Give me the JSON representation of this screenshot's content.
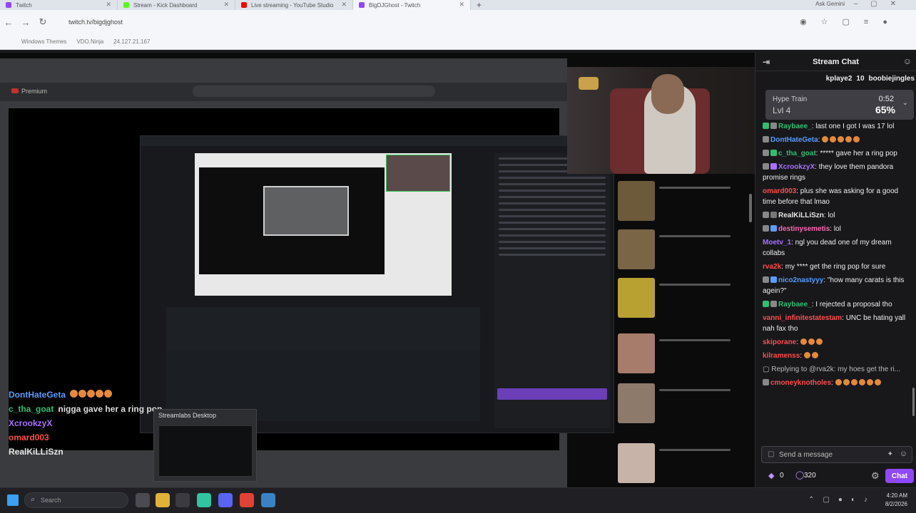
{
  "browser": {
    "tabs": [
      {
        "label": "Twitch",
        "color": "#9147ff",
        "active": false
      },
      {
        "label": "Stream - Kick Dashboard",
        "color": "#53fc18",
        "active": false
      },
      {
        "label": "Live streaming - YouTube Studio",
        "color": "#ff0000",
        "active": false
      },
      {
        "label": "BigDJGhost - Twitch",
        "color": "#9147ff",
        "active": true
      }
    ],
    "ask_gemini": "Ask Gemini",
    "url": "twitch.tv/bigdjghost",
    "bookmarks": [
      "Windows Themes",
      "VDO.Ninja",
      "24.127.21.167"
    ]
  },
  "video": {
    "youtube_logo": "Premium",
    "overlay_chat": [
      {
        "user": "DontHateGeta",
        "color": "#5b9cff",
        "text": ""
      },
      {
        "user": "c_tha_goat",
        "color": "#2fbf71",
        "text": "nigga gave her a ring pop"
      },
      {
        "user": "XcrookzyX",
        "color": "#a970ff",
        "text": ""
      },
      {
        "user": "omard003",
        "color": "#ff4d4d",
        "text": ""
      },
      {
        "user": "RealKiLLiSzn",
        "color": "#e6e6e6",
        "text": ""
      }
    ],
    "streamlabs_popup": "Streamlabs Desktop"
  },
  "chat": {
    "title": "Stream Chat",
    "gifters": [
      {
        "name": "kplaye2",
        "count": "10"
      },
      {
        "name": "boobiejingles",
        "count": ""
      }
    ],
    "hype_train": {
      "label": "Hype Train",
      "level": "Lvl 4",
      "time": "0:52",
      "percent": "65%"
    },
    "messages": [
      {
        "user": "Raybaee_",
        "color": "#2fbf71",
        "text": ": last one I got I was 17 lol"
      },
      {
        "user": "DontHateGeta",
        "color": "#5b9cff",
        "text": ":"
      },
      {
        "user": "c_tha_goat",
        "color": "#2fbf71",
        "text": ": ***** gave her a ring pop"
      },
      {
        "user": "XcrookzyX",
        "color": "#a970ff",
        "text": ": they love them pandora promise rings"
      },
      {
        "user": "omard003",
        "color": "#ff4d4d",
        "text": ": plus she was asking for a good time before that lmao"
      },
      {
        "user": "RealKiLLiSzn",
        "color": "#e6e6e6",
        "text": ": lol"
      },
      {
        "user": "destinysemetis",
        "color": "#ff69b4",
        "text": ": lol"
      },
      {
        "user": "Moetv_1",
        "color": "#a970ff",
        "text": ": ngl you dead one of my dream collabs"
      },
      {
        "user": "rva2k",
        "color": "#ff4d4d",
        "text": ": my **** get the ring pop for sure"
      },
      {
        "user": "nico2nastyyy",
        "color": "#5b9cff",
        "text": ": \"how many carats is this agein?\""
      },
      {
        "user": "Raybaee_",
        "color": "#2fbf71",
        "text": ": I rejected a proposal tho"
      },
      {
        "user": "vanni_infinitestatestam",
        "color": "#ff4d4d",
        "text": ": UNC be hating yall nah fax tho"
      },
      {
        "user": "skiporane",
        "color": "#ff4d4d",
        "text": ":"
      },
      {
        "user": "kilramenss",
        "color": "#ff4d4d",
        "text": ":"
      },
      {
        "user": "",
        "color": "#bbb",
        "text": "Replying to @rva2k: my hoes get the ri..."
      },
      {
        "user": "cmoneyknotholes",
        "color": "#ff4d4d",
        "text": ":"
      }
    ],
    "input_placeholder": "Send a message",
    "points_a": "0",
    "points_b": "320",
    "chat_button": "Chat"
  },
  "taskbar": {
    "search_placeholder": "Search",
    "time": "4:20 AM",
    "date": "8/2/2026"
  }
}
